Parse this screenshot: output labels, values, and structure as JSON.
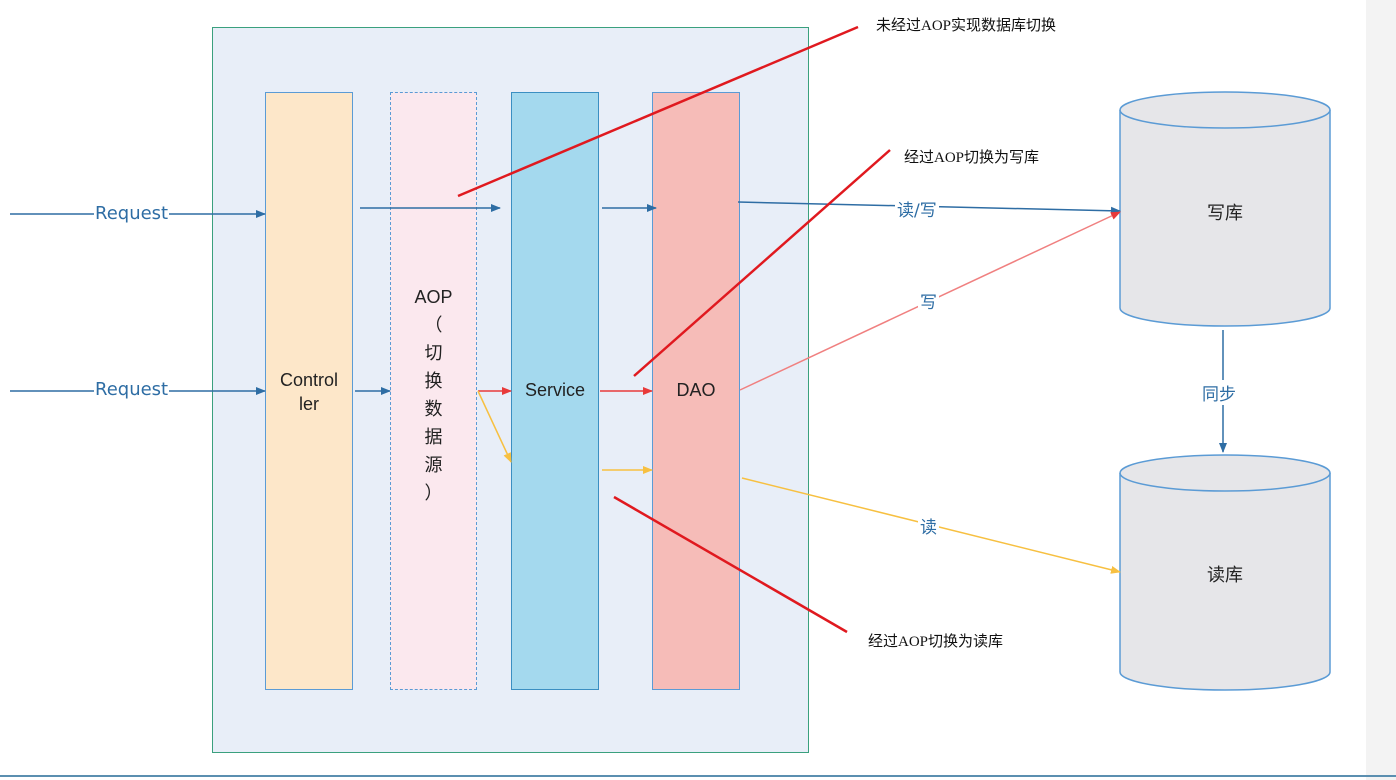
{
  "requests": [
    "Request",
    "Request"
  ],
  "columns": {
    "controller": "Control\nler",
    "aop": [
      "AOP",
      "（",
      "切",
      "换",
      "数",
      "据",
      "源",
      "）"
    ],
    "service": "Service",
    "dao": "DAO"
  },
  "databases": {
    "write": "写库",
    "read": "读库"
  },
  "edges": {
    "read_write": "读/写",
    "write": "写",
    "read": "读",
    "sync": "同步"
  },
  "notes": {
    "no_aop": "未经过AOP实现数据库切换",
    "aop_write": "经过AOP切换为写库",
    "aop_read": "经过AOP切换为读库"
  },
  "colors": {
    "blue_arrow": "#2e6da4",
    "red_arrow": "#e83a3a",
    "yellow_arrow": "#f7c041",
    "note_line": "#e0191f"
  }
}
